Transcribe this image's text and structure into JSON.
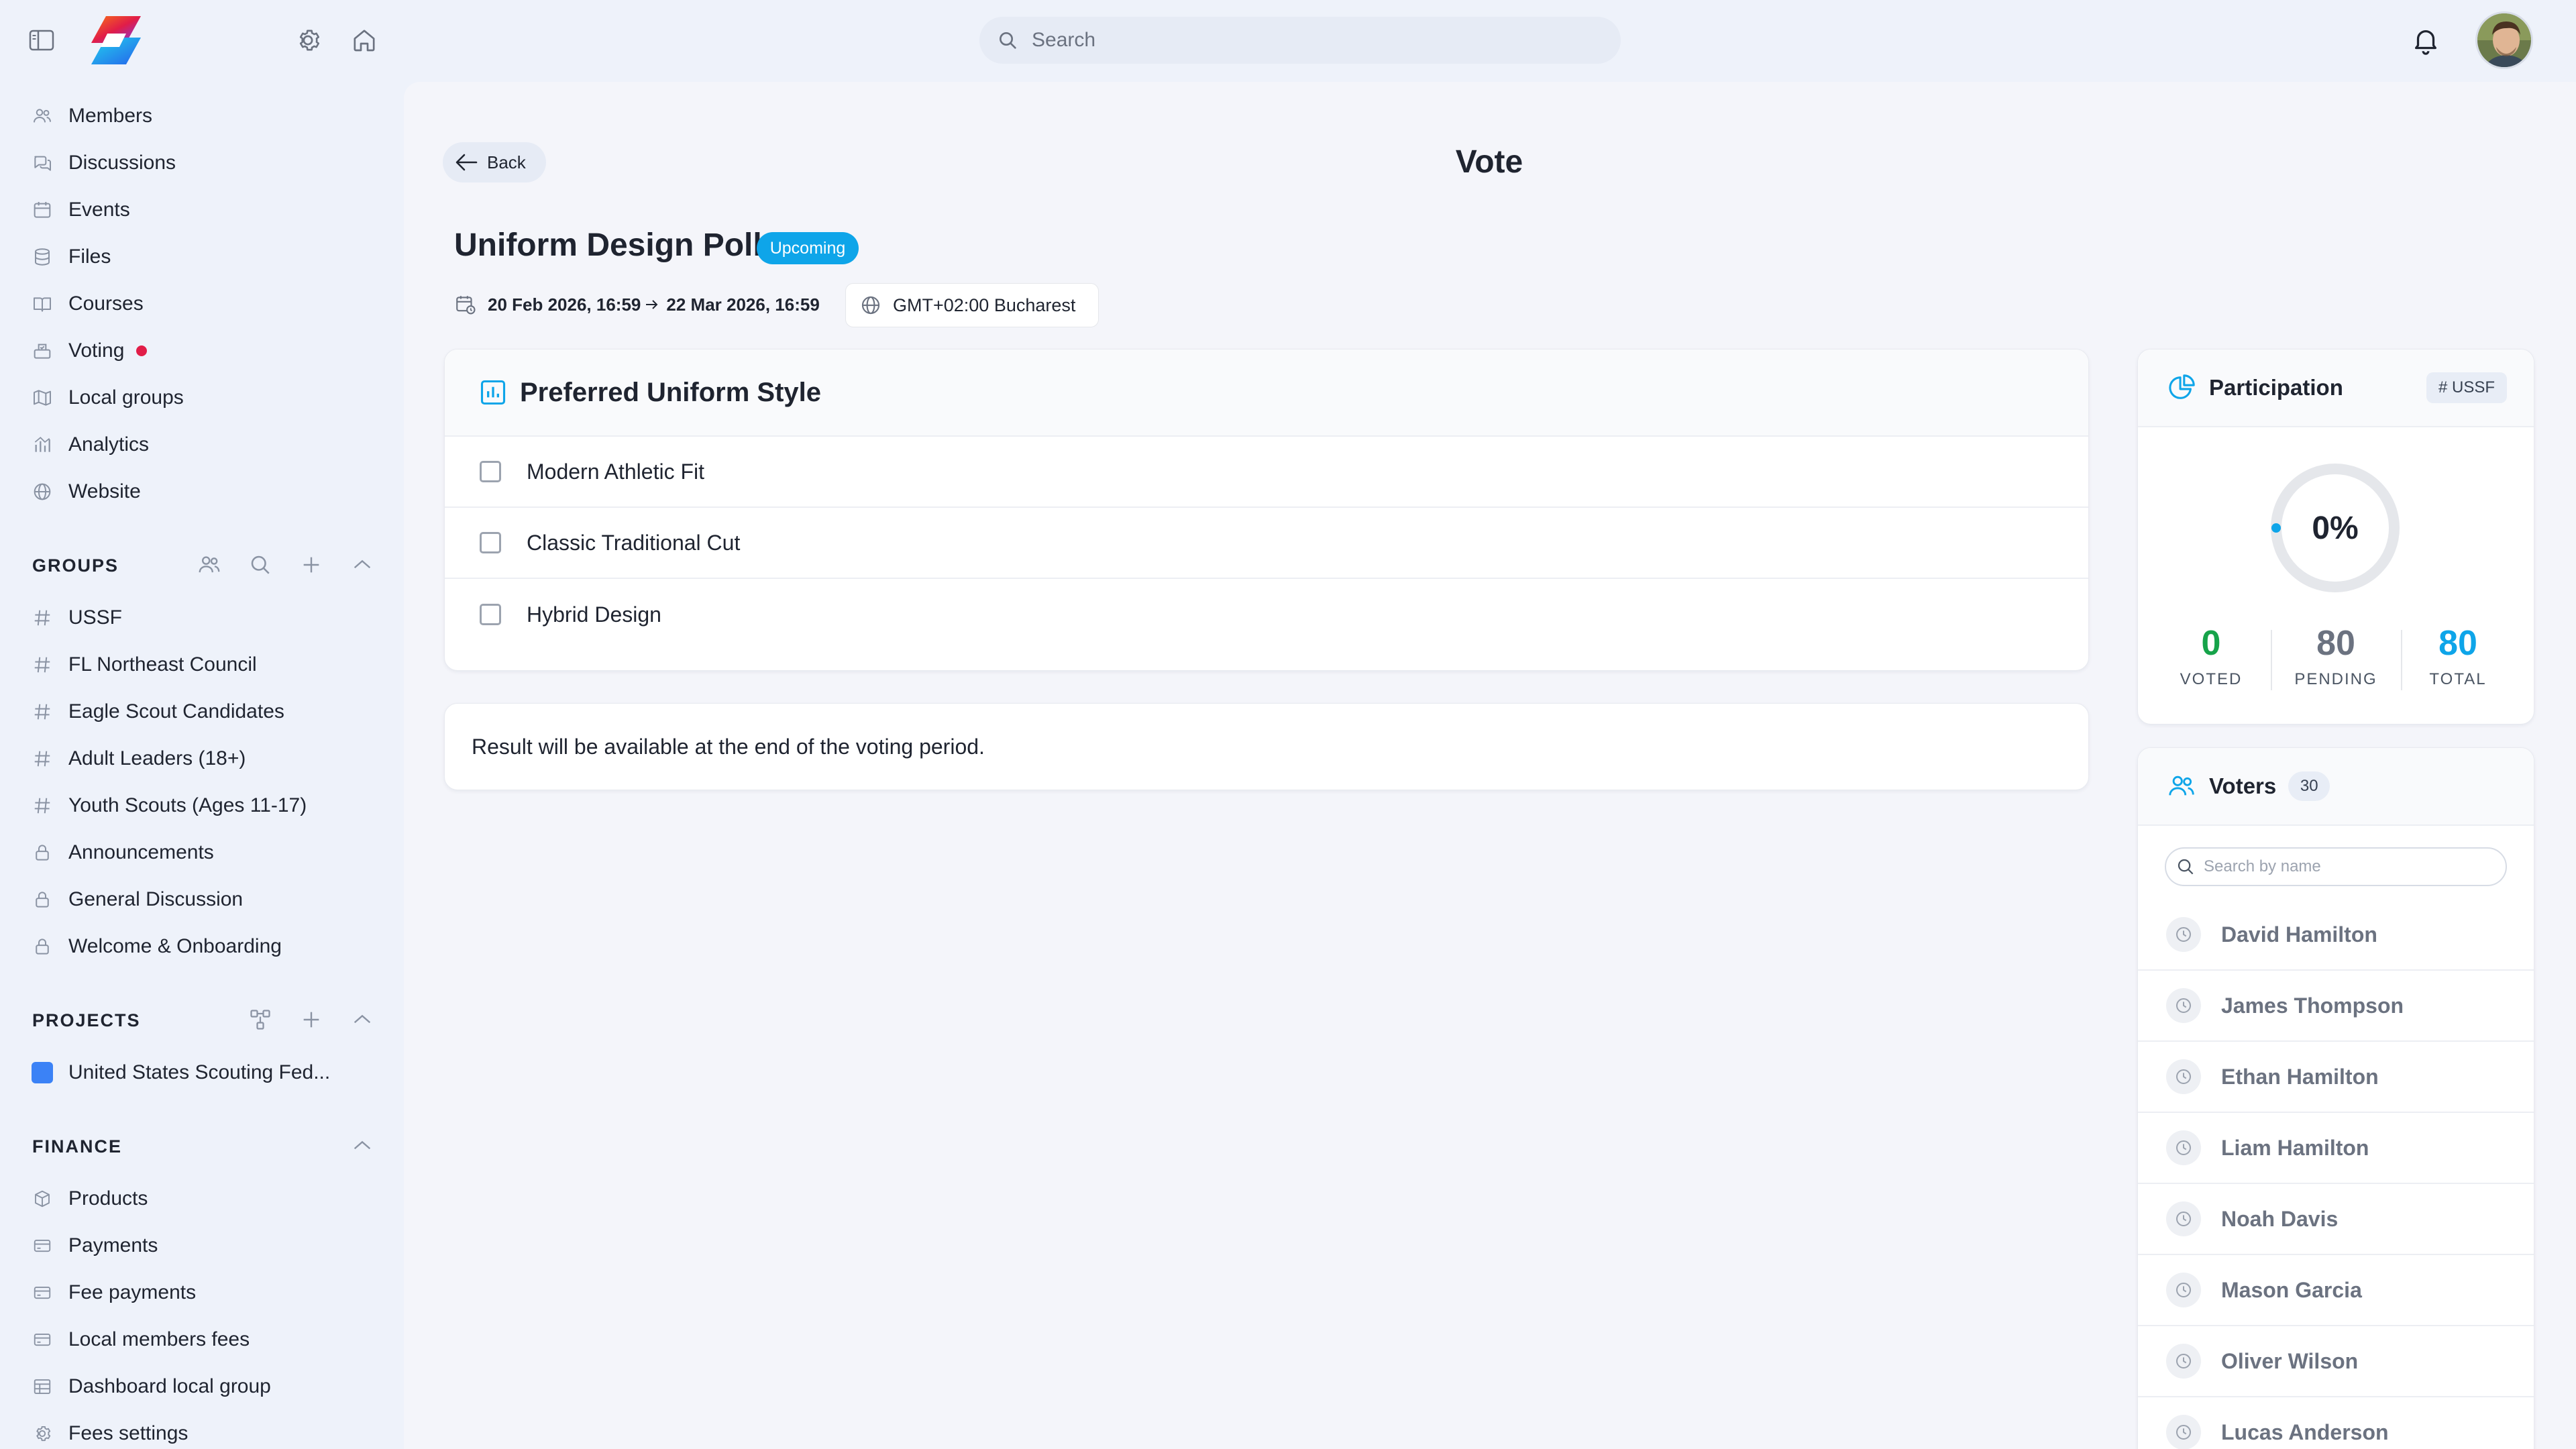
{
  "topbar": {
    "search_placeholder": "Search",
    "icons": [
      "sidebar-toggle-icon",
      "app-logo",
      "gear-icon",
      "home-icon",
      "search-icon",
      "bell-icon",
      "avatar"
    ]
  },
  "sidebar": {
    "nav": [
      {
        "label": "Members",
        "icon": "members-icon"
      },
      {
        "label": "Discussions",
        "icon": "discussions-icon"
      },
      {
        "label": "Events",
        "icon": "calendar-icon"
      },
      {
        "label": "Files",
        "icon": "database-icon"
      },
      {
        "label": "Courses",
        "icon": "book-icon"
      },
      {
        "label": "Voting",
        "icon": "ballot-box-icon",
        "has_dot": true
      },
      {
        "label": "Local groups",
        "icon": "map-icon"
      },
      {
        "label": "Analytics",
        "icon": "analytics-icon"
      },
      {
        "label": "Website",
        "icon": "globe-icon"
      }
    ],
    "groups": {
      "header": "GROUPS",
      "items": [
        {
          "label": "USSF",
          "icon": "hash-icon"
        },
        {
          "label": "FL Northeast Council",
          "icon": "hash-icon"
        },
        {
          "label": "Eagle Scout Candidates",
          "icon": "hash-icon"
        },
        {
          "label": "Adult Leaders (18+)",
          "icon": "hash-icon"
        },
        {
          "label": "Youth Scouts (Ages 11-17)",
          "icon": "hash-icon"
        },
        {
          "label": "Announcements",
          "icon": "lock-icon"
        },
        {
          "label": "General Discussion",
          "icon": "lock-icon"
        },
        {
          "label": "Welcome & Onboarding",
          "icon": "lock-icon"
        }
      ]
    },
    "projects": {
      "header": "PROJECTS",
      "items": [
        {
          "label": "United States Scouting Fed...",
          "color": "#3b82f6"
        }
      ]
    },
    "finance": {
      "header": "FINANCE",
      "items": [
        {
          "label": "Products",
          "icon": "box-icon"
        },
        {
          "label": "Payments",
          "icon": "card-icon"
        },
        {
          "label": "Fee payments",
          "icon": "card-icon"
        },
        {
          "label": "Local members fees",
          "icon": "card-icon"
        },
        {
          "label": "Dashboard local group",
          "icon": "table-icon"
        },
        {
          "label": "Fees settings",
          "icon": "gear-icon"
        }
      ]
    }
  },
  "main": {
    "back_label": "Back",
    "page_title": "Vote",
    "poll": {
      "title": "Uniform Design Poll",
      "status": "Upcoming",
      "start": "20 Feb 2026, 16:59",
      "end": "22 Mar 2026, 16:59",
      "timezone": "GMT+02:00 Bucharest"
    },
    "question": {
      "title": "Preferred Uniform Style",
      "options": [
        "Modern Athletic Fit",
        "Classic Traditional Cut",
        "Hybrid Design"
      ]
    },
    "result_note": "Result will be available at the end of the voting period."
  },
  "participation": {
    "title": "Participation",
    "tag": "# USSF",
    "percent": "0%",
    "percent_value": 0,
    "voted": {
      "value": "0",
      "label": "VOTED"
    },
    "pending": {
      "value": "80",
      "label": "PENDING"
    },
    "total": {
      "value": "80",
      "label": "TOTAL"
    },
    "colors": {
      "voted": "#16a34a",
      "pending": "#6b7280",
      "total": "#0ea5e9",
      "ring": "#e5e7eb",
      "accent": "#0ea5e9"
    }
  },
  "voters": {
    "title": "Voters",
    "count": "30",
    "search_placeholder": "Search by name",
    "list": [
      "David Hamilton",
      "James Thompson",
      "Ethan Hamilton",
      "Liam Hamilton",
      "Noah Davis",
      "Mason Garcia",
      "Oliver Wilson",
      "Lucas Anderson"
    ]
  }
}
